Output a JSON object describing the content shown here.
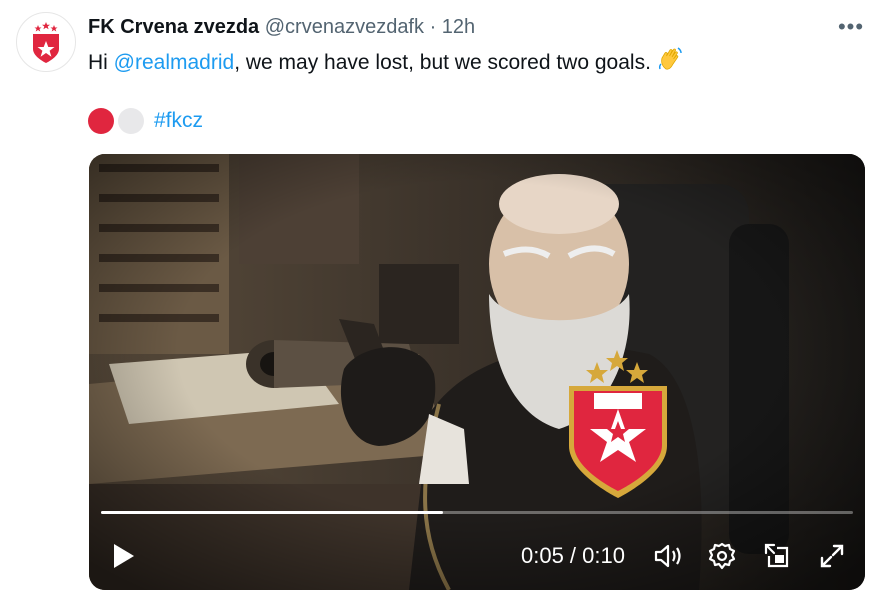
{
  "author": {
    "display_name": "FK Crvena zvezda",
    "handle": "@crvenazvezdafk",
    "separator": "·",
    "time": "12h"
  },
  "text": {
    "greeting": "Hi ",
    "mention": "@realmadrid",
    "body": ", we may have lost, but we scored two goals.",
    "emoji_icon": "waving-hand-icon"
  },
  "hashtag": "#fkcz",
  "colors": {
    "link": "#1d9bf0",
    "club_red": "#e0263f",
    "secondary_text": "#536471"
  },
  "video": {
    "time_display": "0:05 / 0:10",
    "progress": 0.455,
    "controls": [
      "play-icon",
      "volume-icon",
      "settings-icon",
      "pip-icon",
      "fullscreen-icon"
    ]
  }
}
